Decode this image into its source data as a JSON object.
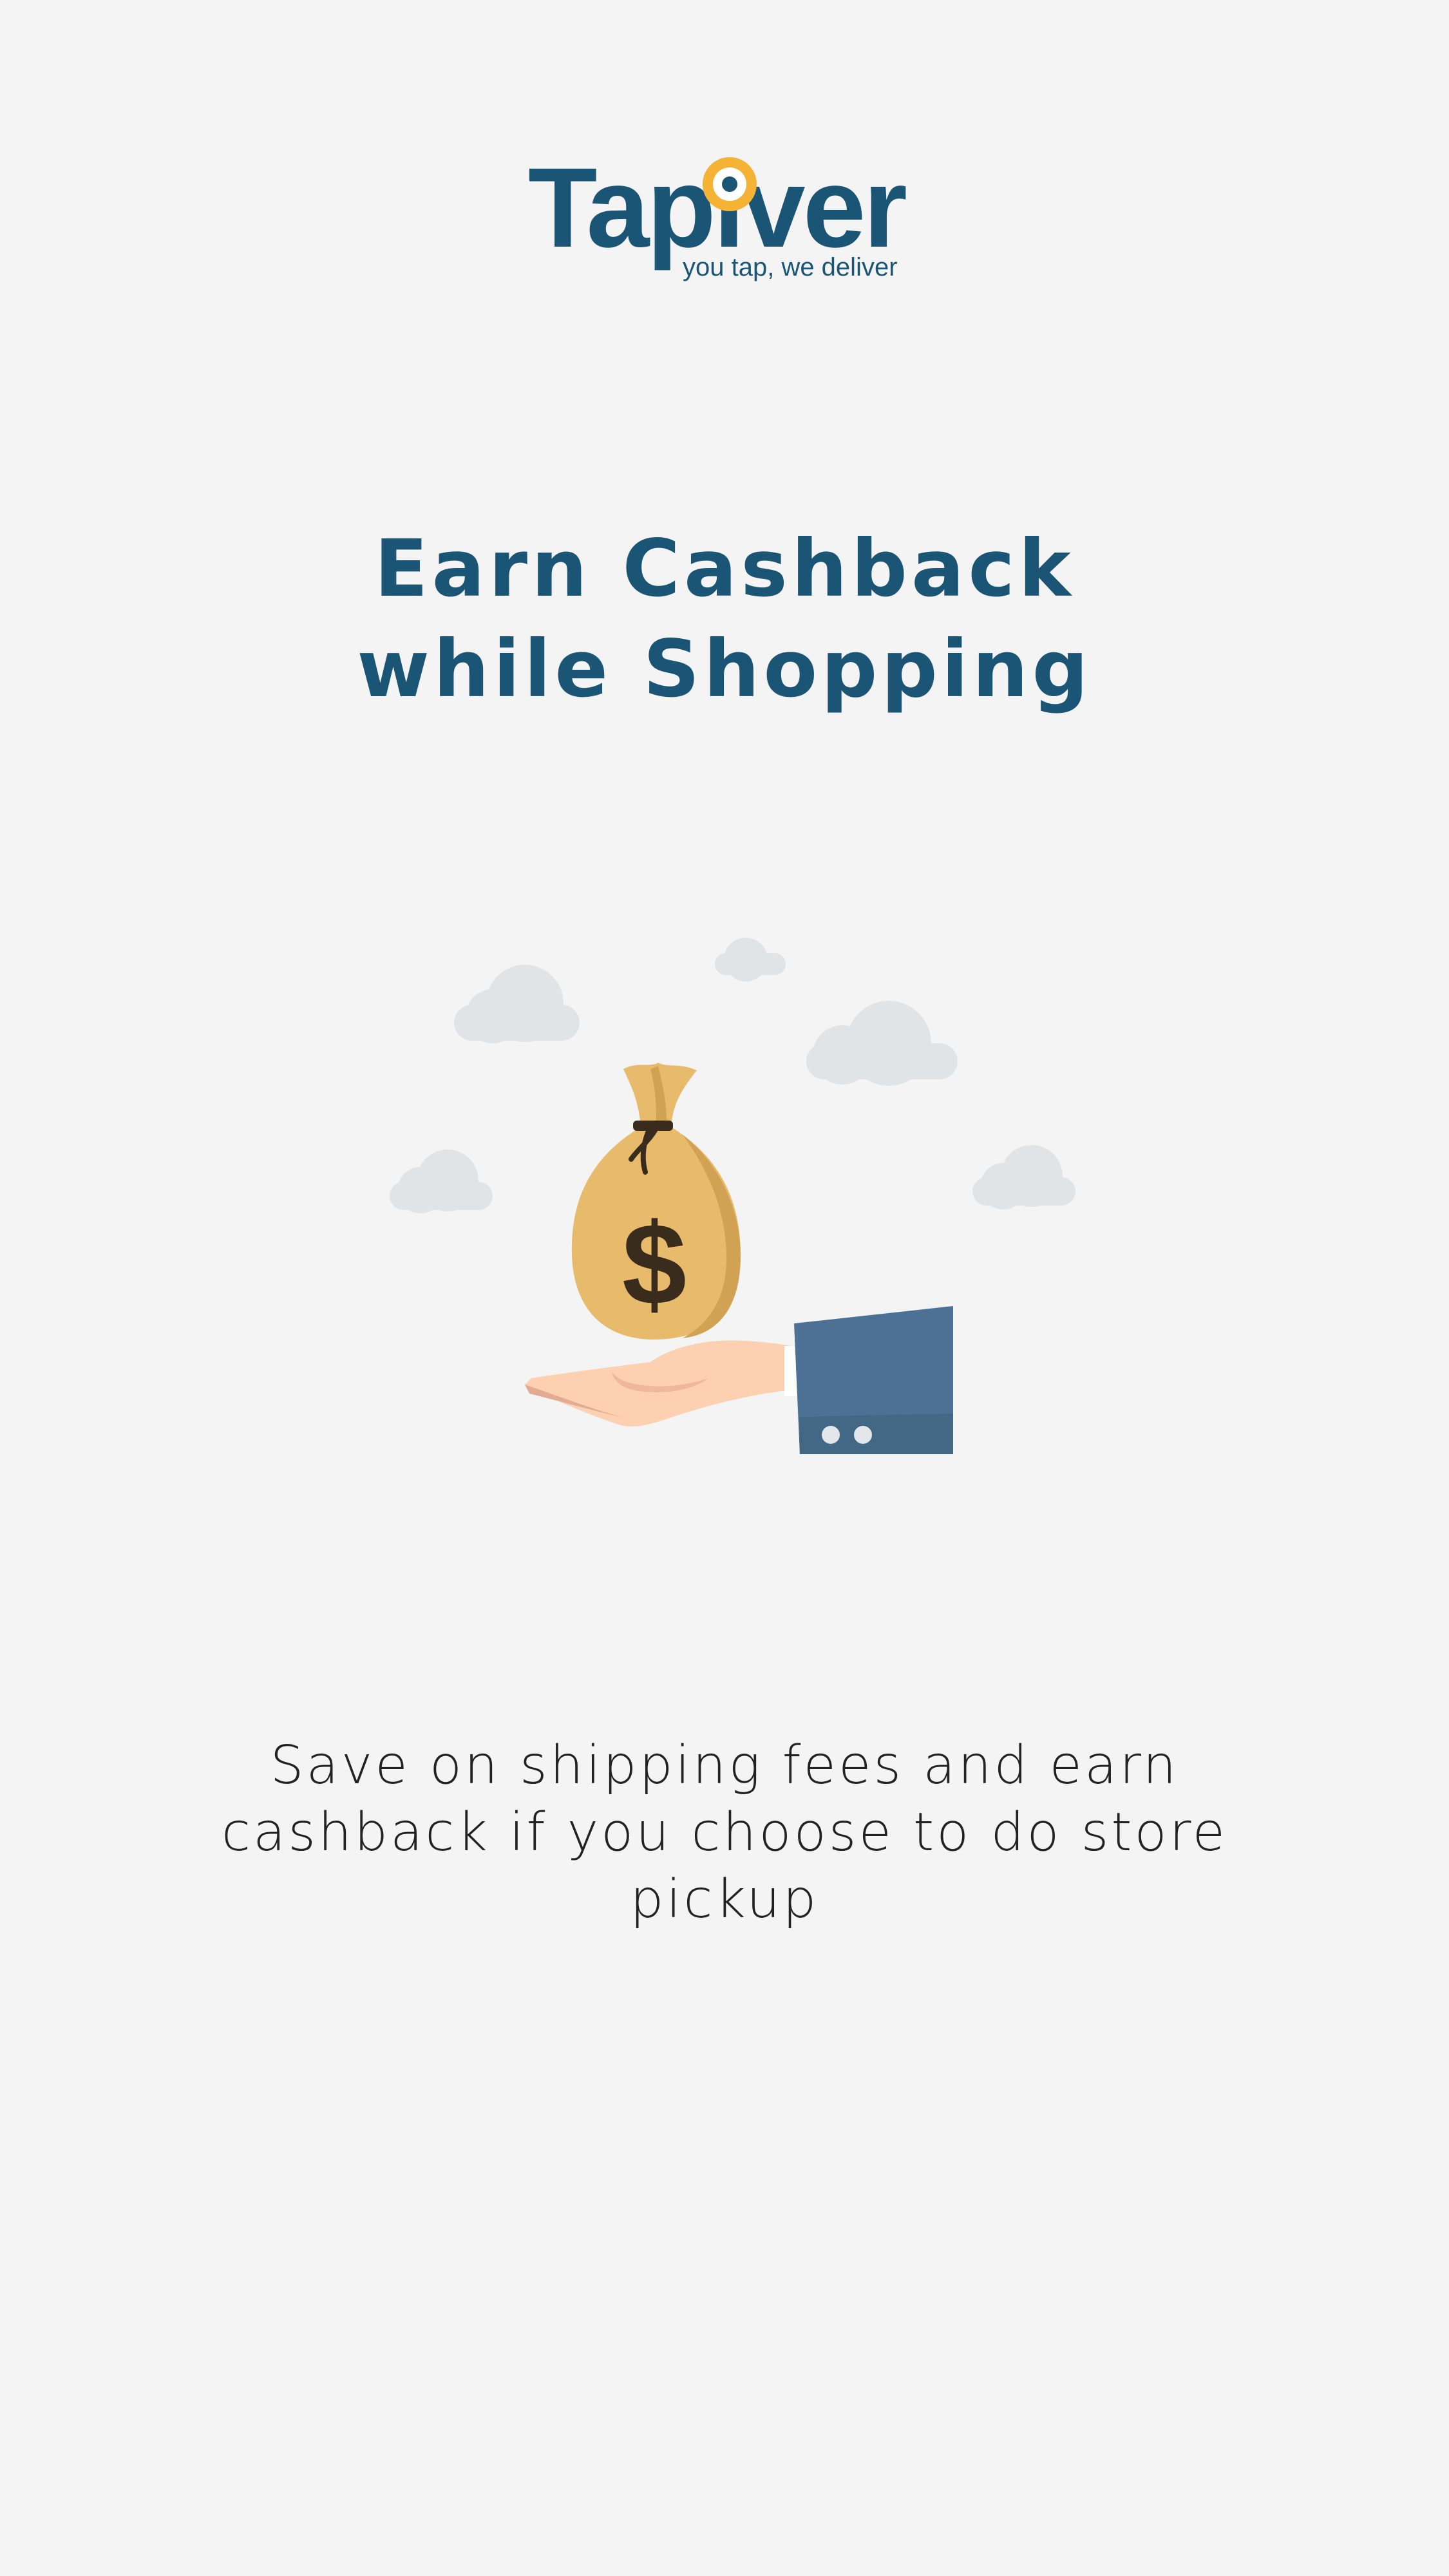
{
  "brand": {
    "name": "Tapiver",
    "tagline": "you tap, we deliver",
    "primary_color": "#1b5575",
    "accent_color": "#f5b335"
  },
  "onboarding": {
    "headline_line1": "Earn Cashback",
    "headline_line2": "while Shopping",
    "illustration_icon": "money-bag-on-hand-icon",
    "illustration_symbol": "$",
    "description": "Save on shipping fees and earn cashback if you choose to do store pickup"
  },
  "colors": {
    "background": "#f4f4f4",
    "text": "#222222",
    "cloud": "#e0e4e7",
    "bag": "#e7bb6b",
    "sleeve": "#4c7194",
    "skin": "#fdd0b1"
  }
}
